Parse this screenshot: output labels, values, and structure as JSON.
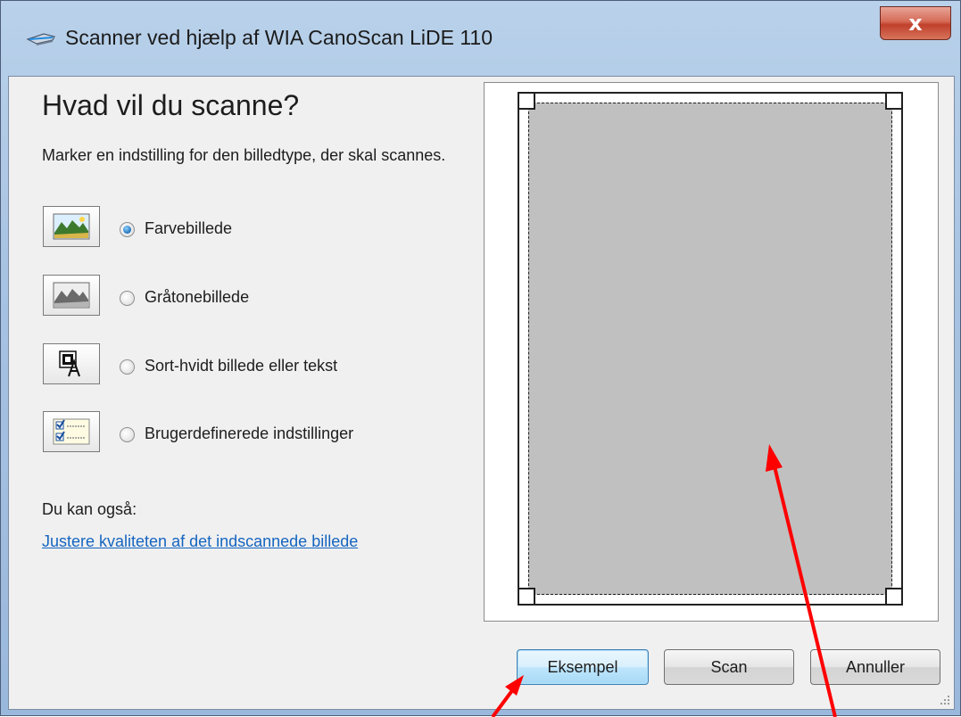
{
  "window": {
    "title": "Scanner ved hjælp af WIA CanoScan LiDE 110",
    "close_glyph": "x"
  },
  "main": {
    "heading": "Hvad vil du scanne?",
    "description": "Marker en indstilling for den billedtype, der skal scannes.",
    "options": [
      {
        "label": "Farvebillede",
        "icon": "color-photo-icon",
        "checked": true
      },
      {
        "label": "Gråtonebillede",
        "icon": "grayscale-photo-icon",
        "checked": false
      },
      {
        "label": "Sort-hvidt billede eller tekst",
        "icon": "black-white-text-icon",
        "checked": false
      },
      {
        "label": "Brugerdefinerede indstillinger",
        "icon": "custom-settings-icon",
        "checked": false
      }
    ],
    "also_label": "Du kan også:",
    "quality_link": "Justere kvaliteten af det indscannede billede"
  },
  "buttons": {
    "preview": "Eksempel",
    "scan": "Scan",
    "cancel": "Annuller"
  },
  "colors": {
    "accent": "#1565c0",
    "annotation_arrow": "#ff0000",
    "scan_area": "#c0c0c0"
  }
}
